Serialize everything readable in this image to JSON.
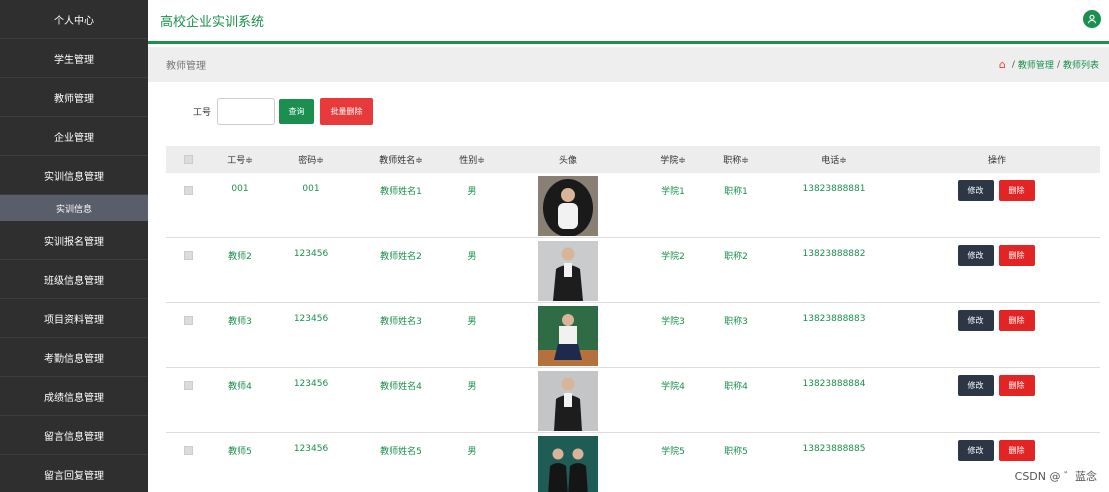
{
  "sidebar": {
    "items": [
      {
        "label": "个人中心"
      },
      {
        "label": "学生管理"
      },
      {
        "label": "教师管理"
      },
      {
        "label": "企业管理"
      },
      {
        "label": "实训信息管理"
      },
      {
        "label": "实训报名管理"
      },
      {
        "label": "班级信息管理"
      },
      {
        "label": "项目资料管理"
      },
      {
        "label": "考勤信息管理"
      },
      {
        "label": "成绩信息管理"
      },
      {
        "label": "留言信息管理"
      },
      {
        "label": "留言回复管理"
      }
    ],
    "subitem": "实训信息"
  },
  "header": {
    "title": "高校企业实训系统"
  },
  "crumb": {
    "page": "教师管理",
    "path1": "教师管理",
    "sep": "/",
    "path2": "教师列表"
  },
  "search": {
    "label": "工号",
    "query_label": "查询",
    "batch_delete_label": "批量删除"
  },
  "table": {
    "headers": {
      "id": "工号≑",
      "pwd": "密码≑",
      "name": "教师姓名≑",
      "gender": "性别≑",
      "avatar": "头像",
      "college": "学院≑",
      "title": "职称≑",
      "phone": "电话≑",
      "ops": "操作"
    },
    "rows": [
      {
        "id": "001",
        "pwd": "001",
        "name": "教师姓名1",
        "gender": "男",
        "college": "学院1",
        "title": "职称1",
        "phone": "13823888881"
      },
      {
        "id": "教师2",
        "pwd": "123456",
        "name": "教师姓名2",
        "gender": "男",
        "college": "学院2",
        "title": "职称2",
        "phone": "13823888882"
      },
      {
        "id": "教师3",
        "pwd": "123456",
        "name": "教师姓名3",
        "gender": "男",
        "college": "学院3",
        "title": "职称3",
        "phone": "13823888883"
      },
      {
        "id": "教师4",
        "pwd": "123456",
        "name": "教师姓名4",
        "gender": "男",
        "college": "学院4",
        "title": "职称4",
        "phone": "13823888884"
      },
      {
        "id": "教师5",
        "pwd": "123456",
        "name": "教师姓名5",
        "gender": "男",
        "college": "学院5",
        "title": "职称5",
        "phone": "13823888885"
      }
    ],
    "edit_label": "修改",
    "delete_label": "删除"
  },
  "watermark": "CSDN @ ゛蓝念"
}
